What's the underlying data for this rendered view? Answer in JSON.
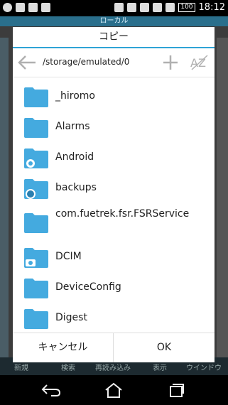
{
  "status_bar": {
    "time": "18:12",
    "battery": "100"
  },
  "background_app": {
    "title": "ローカル",
    "toolbar": [
      "新規",
      "検索",
      "再読み込み",
      "表示",
      "ウインドウ"
    ]
  },
  "dialog": {
    "title": "コピー",
    "path": "/storage/emulated/0",
    "files": [
      "_hiromo",
      "Alarms",
      "Android",
      "backups",
      "com.fuetrek.fsr.FSRService",
      "DCIM",
      "DeviceConfig",
      "Digest"
    ],
    "cancel_label": "キャンセル",
    "ok_label": "OK"
  },
  "colors": {
    "accent": "#2ea3d6",
    "folder": "#44aadf"
  }
}
